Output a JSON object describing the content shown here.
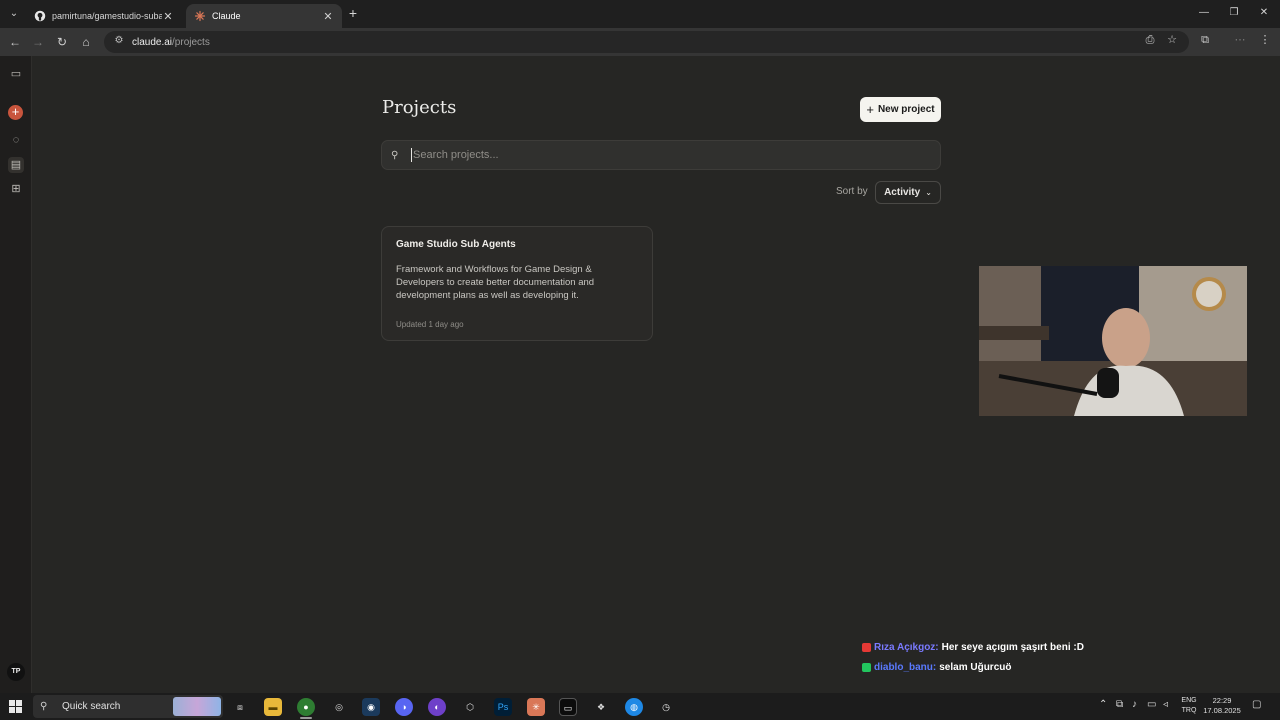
{
  "browser": {
    "tabs": [
      {
        "title": "pamirtuna/gamestudio-subage",
        "active": false
      },
      {
        "title": "Claude",
        "active": true
      }
    ],
    "url_host": "claude.ai",
    "url_path": "/projects"
  },
  "page": {
    "title": "Projects",
    "new_project_label": "New project",
    "search_placeholder": "Search projects...",
    "sort_label": "Sort by",
    "sort_value": "Activity"
  },
  "projects": [
    {
      "title": "Game Studio Sub Agents",
      "description": "Framework and Workflows for Game Design & Developers to create better documentation and development plans as well as developing it.",
      "updated": "Updated 1 day ago"
    }
  ],
  "sidebar": {
    "avatar_initials": "TP"
  },
  "chat": [
    {
      "user": "Rıza Açıkgoz:",
      "message": "Her seye açıgım şaşırt beni :D",
      "badge_color": "#e53935"
    },
    {
      "user": "diablo_banu:",
      "message": "selam Uğurcuö",
      "badge_color": "#22c55e"
    }
  ],
  "taskbar": {
    "search_label": "Quick search",
    "lang_line1": "ENG",
    "lang_line2": "TRQ",
    "time": "22:29",
    "date": "17.08.2025"
  },
  "colors": {
    "accent": "#c8553d",
    "background": "#262624",
    "button_light": "#f5f4ef"
  }
}
